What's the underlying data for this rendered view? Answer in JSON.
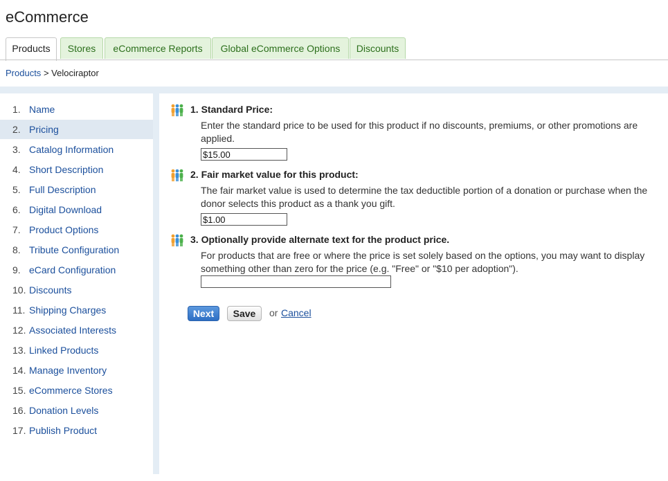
{
  "app": {
    "title": "eCommerce"
  },
  "tabs": [
    {
      "label": "Products",
      "active": true
    },
    {
      "label": "Stores",
      "active": false
    },
    {
      "label": "eCommerce Reports",
      "active": false
    },
    {
      "label": "Global eCommerce Options",
      "active": false
    },
    {
      "label": "Discounts",
      "active": false
    }
  ],
  "breadcrumb": {
    "link": "Products",
    "separator": ">",
    "current": "Velociraptor"
  },
  "sidebar": {
    "items": [
      {
        "num": "1.",
        "label": "Name"
      },
      {
        "num": "2.",
        "label": "Pricing",
        "active": true
      },
      {
        "num": "3.",
        "label": "Catalog Information"
      },
      {
        "num": "4.",
        "label": "Short Description"
      },
      {
        "num": "5.",
        "label": "Full Description"
      },
      {
        "num": "6.",
        "label": "Digital Download"
      },
      {
        "num": "7.",
        "label": "Product Options"
      },
      {
        "num": "8.",
        "label": "Tribute Configuration"
      },
      {
        "num": "9.",
        "label": "eCard Configuration"
      },
      {
        "num": "10.",
        "label": "Discounts"
      },
      {
        "num": "11.",
        "label": "Shipping Charges"
      },
      {
        "num": "12.",
        "label": "Associated Interests"
      },
      {
        "num": "13.",
        "label": "Linked Products"
      },
      {
        "num": "14.",
        "label": "Manage Inventory"
      },
      {
        "num": "15.",
        "label": "eCommerce Stores"
      },
      {
        "num": "16.",
        "label": "Donation Levels"
      },
      {
        "num": "17.",
        "label": "Publish Product"
      }
    ]
  },
  "steps": [
    {
      "title": "1. Standard Price:",
      "description": "Enter the standard price to be used for this product if no discounts, premiums, or other promotions are applied.",
      "value": "$15.00"
    },
    {
      "title": "2. Fair market value for this product:",
      "description": "The fair market value is used to determine the tax deductible portion of a donation or purchase when the donor selects this product as a thank you gift.",
      "value": "$1.00"
    },
    {
      "title": "3. Optionally provide alternate text for the product price.",
      "description": "For products that are free or where the price is set solely based on the options, you may want to display something other than zero for the price (e.g. \"Free\" or \"$10 per adoption\").",
      "value": ""
    }
  ],
  "actions": {
    "next": "Next",
    "save": "Save",
    "or": "or",
    "cancel": "Cancel"
  },
  "icons": {
    "step_icon": "people-icon"
  },
  "colors": {
    "link": "#1b4f9c",
    "tab_bg": "#e4f3dd",
    "tab_text": "#2c6f1c",
    "next_button": "#2d6fc4"
  }
}
